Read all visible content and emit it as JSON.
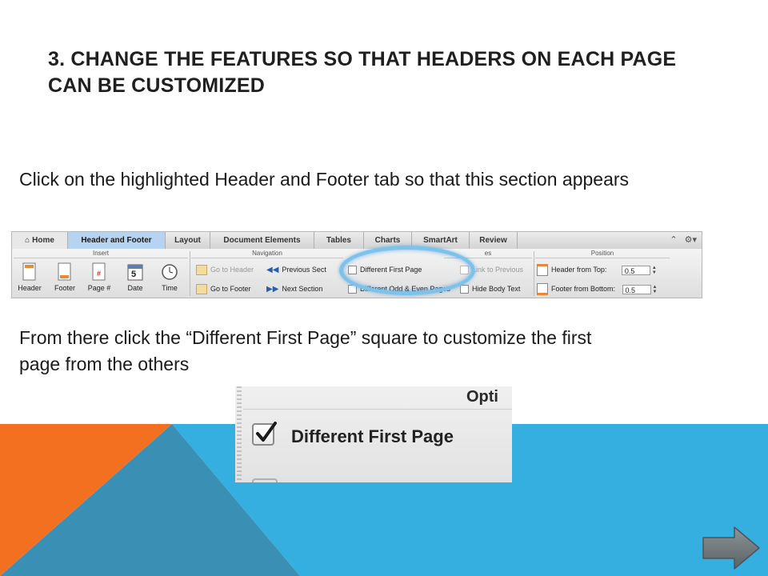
{
  "slide": {
    "title": "3. CHANGE THE FEATURES SO THAT HEADERS ON EACH PAGE CAN BE CUSTOMIZED",
    "instruction_1": "Click on the highlighted Header and Footer tab so that this section appears",
    "instruction_2": "From there click the “Different First Page” square to customize the first page from the others"
  },
  "ribbon": {
    "tabs": [
      "Home",
      "Header and Footer",
      "Layout",
      "Document Elements",
      "Tables",
      "Charts",
      "SmartArt",
      "Review"
    ],
    "active_tab": "Header and Footer",
    "groups": {
      "insert": "Insert",
      "navigation": "Navigation",
      "options": "es",
      "position": "Position"
    },
    "insert_buttons": [
      "Header",
      "Footer",
      "Page #",
      "Date",
      "Time"
    ],
    "date_number": "5",
    "navigation": {
      "go_to_header": "Go to Header",
      "previous_section": "Previous Sect",
      "go_to_footer": "Go to Footer",
      "next_section": "Next Section"
    },
    "options": {
      "different_first_page": "Different First Page",
      "different_odd_even": "Different Odd & Even Pages",
      "link_to_previous": "Link to Previous",
      "hide_body_text": "Hide Body Text"
    },
    "position": {
      "header_from_top_label": "Header from Top:",
      "header_from_top_value": "0.5",
      "footer_from_bottom_label": "Footer from Bottom:",
      "footer_from_bottom_value": "0.5"
    }
  },
  "zoom": {
    "group_label": "Opti",
    "checkbox_label": "Different First Page",
    "checked": true
  },
  "colors": {
    "orange": "#f37021",
    "blue": "#35aee0",
    "steel_blue": "#3a8fb5",
    "highlight": "#7cc2ea"
  },
  "icons": [
    "home-icon",
    "gear-icon",
    "next-slide-arrow-icon",
    "checkmark-icon"
  ]
}
